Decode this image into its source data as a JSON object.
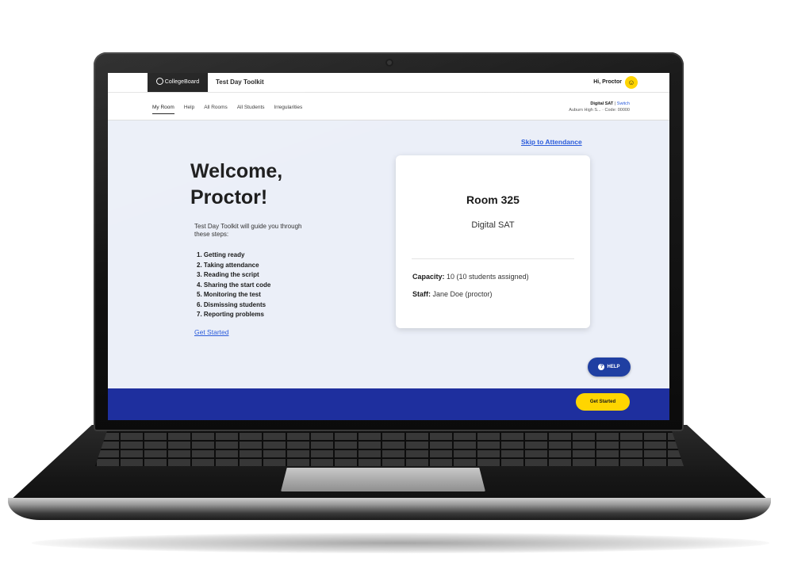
{
  "header": {
    "logo_text": "CollegeBoard",
    "app_title": "Test Day Toolkit",
    "greeting": "Hi, Proctor"
  },
  "nav": {
    "tabs": [
      {
        "label": "My Room",
        "active": true
      },
      {
        "label": "Help"
      },
      {
        "label": "All Rooms"
      },
      {
        "label": "All Students"
      },
      {
        "label": "Irregularities"
      }
    ],
    "test_name": "Digital SAT",
    "switch_label": "Switch",
    "school": "Auburn High S... · Code: 00000"
  },
  "main": {
    "skip_link": "Skip to Attendance",
    "welcome_line1": "Welcome,",
    "welcome_line2": "Proctor!",
    "intro": "Test Day Toolkit will guide you through these steps:",
    "steps": [
      "1. Getting ready",
      "2. Taking attendance",
      "3. Reading the script",
      "4. Sharing the start code",
      "5. Monitoring the test",
      "6. Dismissing students",
      "7. Reporting problems"
    ],
    "get_started_link": "Get Started"
  },
  "room_card": {
    "room_name": "Room 325",
    "test_type": "Digital SAT",
    "capacity_label": "Capacity:",
    "capacity_value": "10 (10 students assigned)",
    "staff_label": "Staff:",
    "staff_value": "Jane Doe (proctor)"
  },
  "help_button": "HELP",
  "footer": {
    "button_label": "Get Started"
  },
  "colors": {
    "brand_blue": "#1e2f9e",
    "accent_yellow": "#ffd500",
    "link_blue": "#2b5cdb",
    "page_bg": "#ebeff8"
  }
}
